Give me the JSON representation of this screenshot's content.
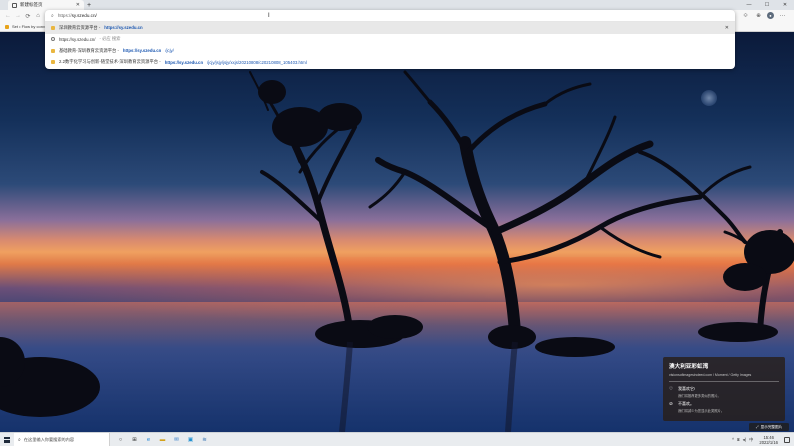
{
  "browser": {
    "tab": {
      "title": "新建标签页",
      "close": "✕"
    },
    "new_tab": "+",
    "window_controls": {
      "minimize": "—",
      "maximize": "☐",
      "close": "✕"
    }
  },
  "toolbar": {
    "back": "←",
    "forward": "→",
    "refresh": "⟳",
    "home": "⌂",
    "right_icons": [
      "☆",
      "⟐",
      "⊕"
    ],
    "profile": "●",
    "menu": "⋯"
  },
  "favorites_bar": {
    "items": [
      {
        "label": "Set • Flow by convers"
      }
    ]
  },
  "omnibox": {
    "icon": "⌕",
    "url_prefix": "https://",
    "url_typed": "sy.szedu.cn/",
    "suggestions": [
      {
        "icon": "site",
        "text": "深圳教育云资源平台 - ",
        "link": "https://sy.szedu.cn",
        "path": "",
        "selected": true,
        "remove": "✕"
      },
      {
        "icon": "search",
        "text": "https://sy.szedu.cn/",
        "link": "",
        "path": "",
        "muted": " - 必应 搜索",
        "selected": false
      },
      {
        "icon": "site",
        "text": "基础教育-深圳教育云资源平台 - ",
        "link": "https://sy.szedu.cn",
        "path": "/jcjy/",
        "selected": false
      },
      {
        "icon": "site",
        "text": "2.2数字化学习与创新-随堂技术-深圳教育云资源平台 - ",
        "link": "https://sy.szedu.cn",
        "path": "/jcjy/jsjy/jsjy/xxjs/20210808/c20210808_105403.html",
        "selected": false
      }
    ]
  },
  "infocard": {
    "title": "澳大利亚彩虹湾",
    "credit": "visionsofimagesindeed.com / Moment / Getty Images",
    "rows": [
      {
        "icon": "♡",
        "main": "我喜欢它!",
        "sub": "我们将推荐更多类似的照片。"
      },
      {
        "icon": "⊘",
        "main": "不喜欢。",
        "sub": "我们将减少为您显示此类照片。"
      }
    ]
  },
  "ms_link": {
    "icon": "⤢",
    "label": "显示完整图片"
  },
  "taskbar": {
    "search_placeholder": "在这里输入你要搜索的内容",
    "icons": [
      {
        "glyph": "○",
        "color": "#333333"
      },
      {
        "glyph": "⊞",
        "color": "#333333"
      },
      {
        "glyph": "e",
        "color": "#0a7bd6"
      },
      {
        "glyph": "▬",
        "color": "#d4a21a"
      },
      {
        "glyph": "✉",
        "color": "#1f6fc5"
      },
      {
        "glyph": "▣",
        "color": "#1d8fd1"
      },
      {
        "glyph": "≋",
        "color": "#2a6db0"
      }
    ],
    "tray": {
      "chevron": "^",
      "network": "⌸",
      "volume": "◂)",
      "ime": "中",
      "time": "15:46",
      "date": "2022/1/16"
    }
  }
}
